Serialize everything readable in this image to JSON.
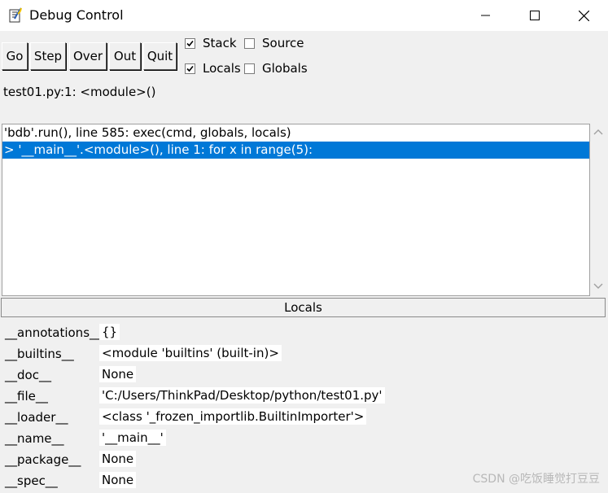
{
  "window": {
    "title": "Debug Control",
    "minimize_icon": "minimize-icon",
    "maximize_icon": "maximize-icon",
    "close_icon": "close-icon"
  },
  "toolbar": {
    "buttons": [
      "Go",
      "Step",
      "Over",
      "Out",
      "Quit"
    ]
  },
  "options": {
    "stack": {
      "label": "Stack",
      "checked": true
    },
    "source": {
      "label": "Source",
      "checked": false
    },
    "locals": {
      "label": "Locals",
      "checked": true
    },
    "globals": {
      "label": "Globals",
      "checked": false
    }
  },
  "status": "test01.py:1: <module>()",
  "stack_lines": [
    {
      "text": "'bdb'.run(), line 585: exec(cmd, globals, locals)",
      "selected": false
    },
    {
      "text": "> '__main__'.<module>(), line 1: for x in range(5):",
      "selected": true
    }
  ],
  "locals": {
    "header": "Locals",
    "rows": [
      {
        "name": "__annotations__",
        "value": "{}"
      },
      {
        "name": "__builtins__",
        "value": "<module 'builtins' (built-in)>"
      },
      {
        "name": "__doc__",
        "value": "None"
      },
      {
        "name": "__file__",
        "value": "'C:/Users/ThinkPad/Desktop/python/test01.py'"
      },
      {
        "name": "__loader__",
        "value": "<class '_frozen_importlib.BuiltinImporter'>"
      },
      {
        "name": "__name__",
        "value": "'__main__'"
      },
      {
        "name": "__package__",
        "value": "None"
      },
      {
        "name": "__spec__",
        "value": "None"
      }
    ]
  },
  "watermark": "CSDN @吃饭睡觉打豆豆",
  "colors": {
    "selection": "#0078d7",
    "background": "#f0f0f0"
  }
}
